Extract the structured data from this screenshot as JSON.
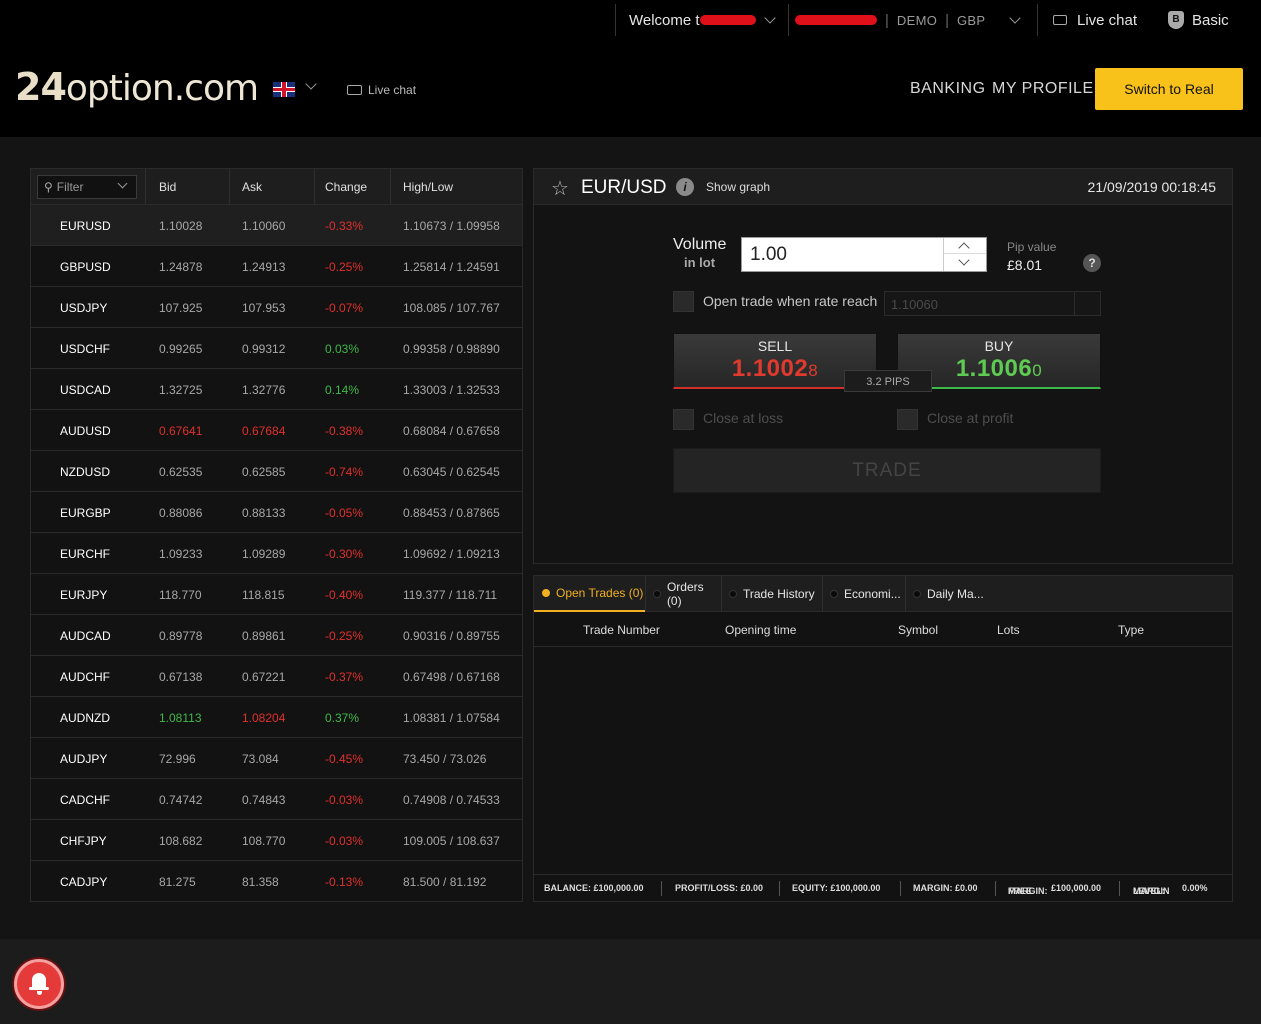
{
  "topbar": {
    "welcome": "Welcome t",
    "account_type": "DEMO",
    "currency": "GBP",
    "live_chat": "Live chat",
    "badge_letter": "B",
    "level": "Basic"
  },
  "header": {
    "logo_num": "24",
    "logo_text": "option.com",
    "live_chat": "Live chat",
    "banking": "BANKING",
    "my_profile": "MY PROFILE",
    "switch_btn": "Switch to Real"
  },
  "rates": {
    "filter": "Filter",
    "columns": [
      "Bid",
      "Ask",
      "Change",
      "High/Low"
    ],
    "rows": [
      {
        "symbol": "EURUSD",
        "bid": "1.10028",
        "ask": "1.10060",
        "change": "-0.33%",
        "highlow": "1.10673 / 1.09958"
      },
      {
        "symbol": "GBPUSD",
        "bid": "1.24878",
        "ask": "1.24913",
        "change": "-0.25%",
        "highlow": "1.25814 / 1.24591"
      },
      {
        "symbol": "USDJPY",
        "bid": "107.925",
        "ask": "107.953",
        "change": "-0.07%",
        "highlow": "108.085 / 107.767"
      },
      {
        "symbol": "USDCHF",
        "bid": "0.99265",
        "ask": "0.99312",
        "change": "0.03%",
        "highlow": "0.99358 / 0.98890"
      },
      {
        "symbol": "USDCAD",
        "bid": "1.32725",
        "ask": "1.32776",
        "change": "0.14%",
        "highlow": "1.33003 / 1.32533"
      },
      {
        "symbol": "AUDUSD",
        "bid": "0.67641",
        "ask": "0.67684",
        "change": "-0.38%",
        "highlow": "0.68084 / 0.67658"
      },
      {
        "symbol": "NZDUSD",
        "bid": "0.62535",
        "ask": "0.62585",
        "change": "-0.74%",
        "highlow": "0.63045 / 0.62545"
      },
      {
        "symbol": "EURGBP",
        "bid": "0.88086",
        "ask": "0.88133",
        "change": "-0.05%",
        "highlow": "0.88453 / 0.87865"
      },
      {
        "symbol": "EURCHF",
        "bid": "1.09233",
        "ask": "1.09289",
        "change": "-0.30%",
        "highlow": "1.09692 / 1.09213"
      },
      {
        "symbol": "EURJPY",
        "bid": "118.770",
        "ask": "118.815",
        "change": "-0.40%",
        "highlow": "119.377 / 118.711"
      },
      {
        "symbol": "AUDCAD",
        "bid": "0.89778",
        "ask": "0.89861",
        "change": "-0.25%",
        "highlow": "0.90316 / 0.89755"
      },
      {
        "symbol": "AUDCHF",
        "bid": "0.67138",
        "ask": "0.67221",
        "change": "-0.37%",
        "highlow": "0.67498 / 0.67168"
      },
      {
        "symbol": "AUDNZD",
        "bid": "1.08113",
        "ask": "1.08204",
        "change": "0.37%",
        "highlow": "1.08381 / 1.07584"
      },
      {
        "symbol": "AUDJPY",
        "bid": "72.996",
        "ask": "73.084",
        "change": "-0.45%",
        "highlow": "73.450 / 73.026"
      },
      {
        "symbol": "CADCHF",
        "bid": "0.74742",
        "ask": "0.74843",
        "change": "-0.03%",
        "highlow": "0.74908 / 0.74533"
      },
      {
        "symbol": "CHFJPY",
        "bid": "108.682",
        "ask": "108.770",
        "change": "-0.03%",
        "highlow": "109.005 / 108.637"
      },
      {
        "symbol": "CADJPY",
        "bid": "81.275",
        "ask": "81.358",
        "change": "-0.13%",
        "highlow": "81.500 / 81.192"
      }
    ]
  },
  "trade": {
    "pair": "EUR/USD",
    "info_glyph": "i",
    "show_graph": "Show graph",
    "datetime": "21/09/2019 00:18:45",
    "volume_label": "Volume",
    "volume_sub": "in lot",
    "volume_value": "1.00",
    "pip_label": "Pip value",
    "pip_value": "£8.01",
    "help_glyph": "?",
    "open_when_label": "Open trade when rate reach",
    "open_when_value": "1.10060",
    "sell": {
      "label": "SELL",
      "price_main": "1.1002",
      "price_last": "8"
    },
    "buy": {
      "label": "BUY",
      "price_main": "1.1006",
      "price_last": "0"
    },
    "pips": "3.2 PIPS",
    "close_loss": "Close at loss",
    "close_profit": "Close at profit",
    "trade_btn": "TRADE"
  },
  "trades_panel": {
    "tabs": [
      "Open Trades (0)",
      "Orders (0)",
      "Trade History",
      "Economi...",
      "Daily Ma..."
    ],
    "columns": [
      "Trade Number",
      "Opening time",
      "Symbol",
      "Lots",
      "Type"
    ],
    "status": {
      "balance": "BALANCE: £100,000.00",
      "pl": "PROFIT/LOSS: £0.00",
      "equity": "EQUITY: £100,000.00",
      "margin": "MARGIN: £0.00",
      "free_label_1": "FREE",
      "free_label_2": "MARGIN:",
      "free_value": "£100,000.00",
      "level_label_1": "MARGIN",
      "level_label_2": "LEVEL:",
      "level_value": "0.00%"
    }
  },
  "colors": {
    "accent": "#f8c21a",
    "negative": "#e0302c",
    "positive": "#3fb84a"
  }
}
